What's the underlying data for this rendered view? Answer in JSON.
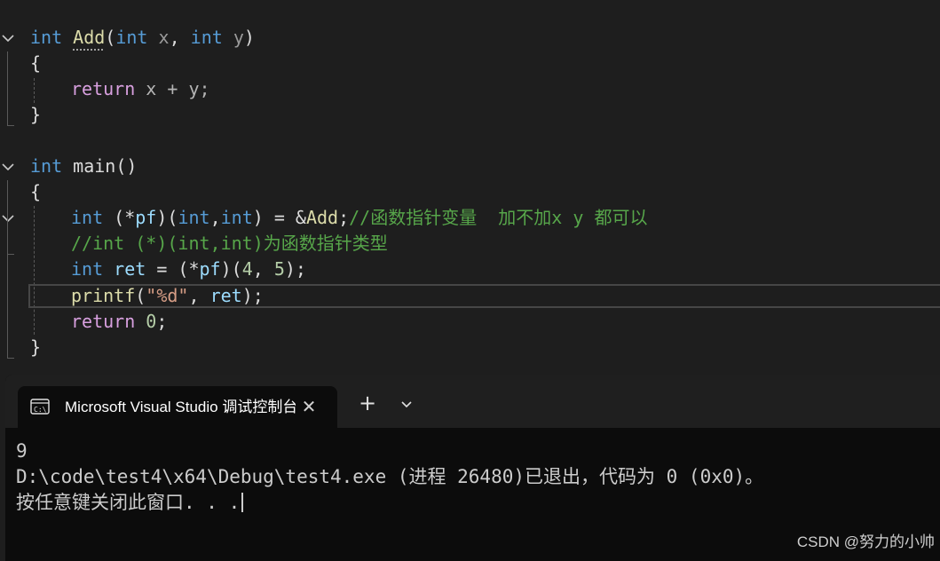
{
  "editor": {
    "code": {
      "l1": {
        "kw1": "int",
        "fn": "Add",
        "p1": "(",
        "kw2": "int",
        "v1": " x",
        "c1": ", ",
        "kw3": "int",
        "v2": " y",
        "p2": ")"
      },
      "l2": {
        "t": "{"
      },
      "l3": {
        "kw": "return",
        "rest": " x + y;"
      },
      "l4": {
        "t": "}"
      },
      "l5": {
        "kw": "int",
        "rest": " main()"
      },
      "l6": {
        "t": "{"
      },
      "l7": {
        "kw1": "int",
        "a": " (*",
        "v": "pf",
        "b": ")(",
        "kw2": "int",
        ",": ",",
        "kw3": "int",
        "c": ") = &",
        "fn": "Add",
        ";": ";",
        "cm": "//函数指针变量  加不加x y 都可以"
      },
      "l8": {
        "cm": "//int (*)(int,int)为函数指针类型"
      },
      "l9": {
        "kw": "int",
        "v": " ret",
        "a": " = (*",
        "v2": "pf",
        "b": ")(",
        "n1": "4",
        ",": ", ",
        "n2": "5",
        "c": ");"
      },
      "l10": {
        "fn": "printf",
        "a": "(",
        "str": "\"%d\"",
        "b": ", ",
        "v": "ret",
        "c": ");"
      },
      "l11": {
        "kw": "return",
        "sp": " ",
        "n": "0",
        ";": ";"
      },
      "l12": {
        "t": "}"
      }
    },
    "icons": [
      "chevron-down-icon"
    ]
  },
  "terminal": {
    "tab_title": "Microsoft Visual Studio 调试控制台",
    "output_line1": "9",
    "output_line2": "D:\\code\\test4\\x64\\Debug\\test4.exe (进程 26480)已退出，代码为 0 (0x0)。",
    "output_line3": "按任意键关闭此窗口. . .",
    "icons": [
      "terminal-icon",
      "close-icon",
      "plus-icon",
      "chevron-down-icon"
    ]
  },
  "watermark": "CSDN @努力的小帅"
}
